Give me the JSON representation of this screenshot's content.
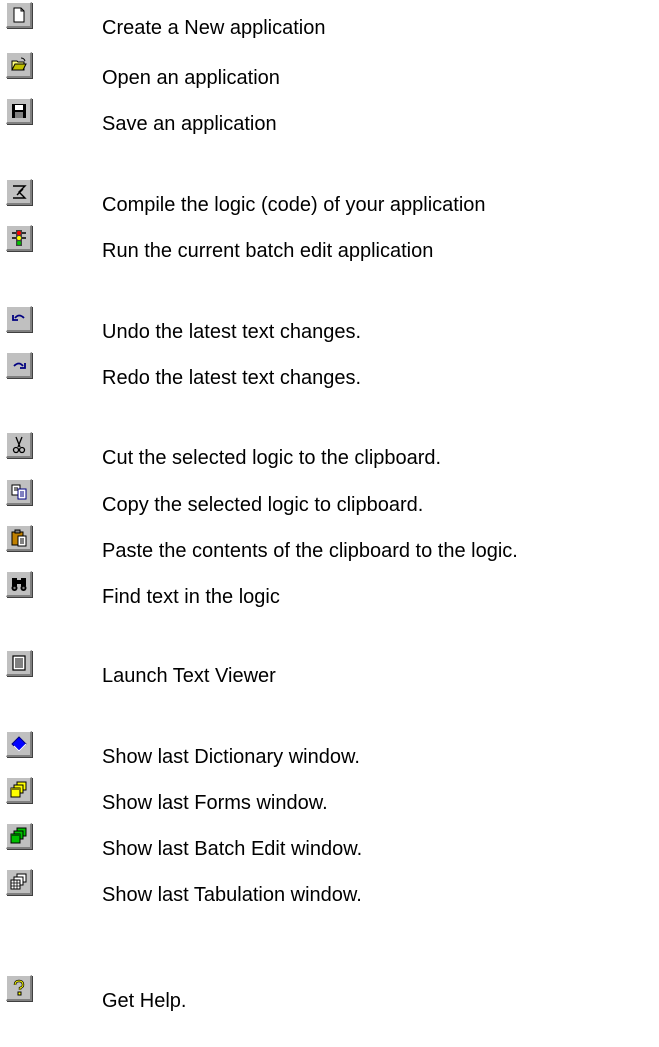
{
  "items": [
    {
      "icon": "new-document-icon",
      "label": "Create a New application"
    },
    {
      "icon": "open-folder-icon",
      "label": "Open an application"
    },
    {
      "icon": "save-disk-icon",
      "label": "Save an application"
    },
    {
      "icon": "compile-icon",
      "label": "Compile the logic (code) of your application"
    },
    {
      "icon": "run-traffic-light-icon",
      "label": "Run the current batch edit application"
    },
    {
      "icon": "undo-icon",
      "label": "Undo the latest text changes."
    },
    {
      "icon": "redo-icon",
      "label": "Redo the latest text changes."
    },
    {
      "icon": "cut-scissors-icon",
      "label": "Cut the selected logic to the clipboard."
    },
    {
      "icon": "copy-icon",
      "label": "Copy the selected logic to clipboard."
    },
    {
      "icon": "paste-clipboard-icon",
      "label": "Paste the contents of the clipboard to the logic."
    },
    {
      "icon": "find-binoculars-icon",
      "label": "Find text in the logic"
    },
    {
      "icon": "text-viewer-icon",
      "label": "Launch Text Viewer"
    },
    {
      "icon": "dictionary-book-icon",
      "label": "Show last Dictionary window."
    },
    {
      "icon": "forms-window-icon",
      "label": "Show last Forms window."
    },
    {
      "icon": "batch-edit-window-icon",
      "label": "Show last Batch Edit window."
    },
    {
      "icon": "tabulation-window-icon",
      "label": "Show last Tabulation window."
    },
    {
      "icon": "help-question-icon",
      "label": "Get Help."
    }
  ]
}
